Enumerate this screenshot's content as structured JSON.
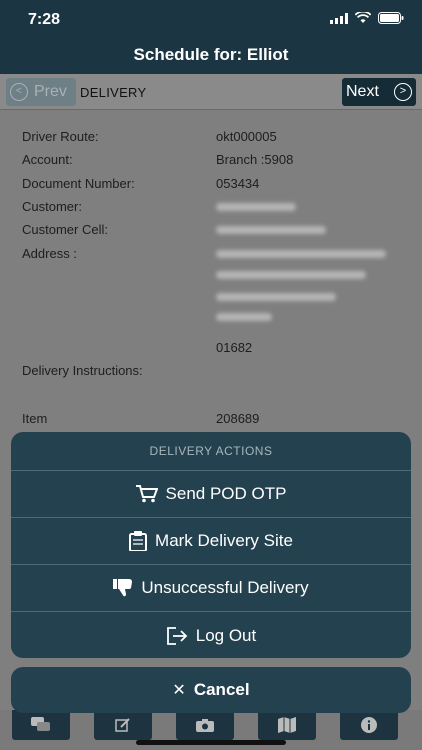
{
  "status": {
    "time": "7:28"
  },
  "header": {
    "title": "Schedule for: Elliot"
  },
  "nav": {
    "prev_label": "Prev",
    "next_label": "Next",
    "section": "DELIVERY"
  },
  "details": [
    {
      "label": "Driver Route:",
      "value": "okt000005"
    },
    {
      "label": "Account:",
      "value": "Branch :5908"
    },
    {
      "label": "Document Number:",
      "value": "053434"
    },
    {
      "label": "Customer:",
      "value": ""
    },
    {
      "label": "Customer Cell:",
      "value": ""
    },
    {
      "label": "Address :",
      "value": ""
    }
  ],
  "address_postcode": "01682",
  "instructions_label": "Delivery Instructions:",
  "item": {
    "label": "Item",
    "value": "208689"
  },
  "action_sheet": {
    "title": "DELIVERY ACTIONS",
    "actions": [
      {
        "label": "Send POD OTP",
        "icon": "cart-icon"
      },
      {
        "label": "Mark Delivery Site",
        "icon": "clipboard-icon"
      },
      {
        "label": "Unsuccessful Delivery",
        "icon": "thumbs-down-icon"
      },
      {
        "label": "Log Out",
        "icon": "logout-icon"
      }
    ],
    "cancel_label": "Cancel"
  },
  "tabs": [
    "chat-icon",
    "edit-icon",
    "camera-icon",
    "map-icon",
    "info-icon"
  ]
}
